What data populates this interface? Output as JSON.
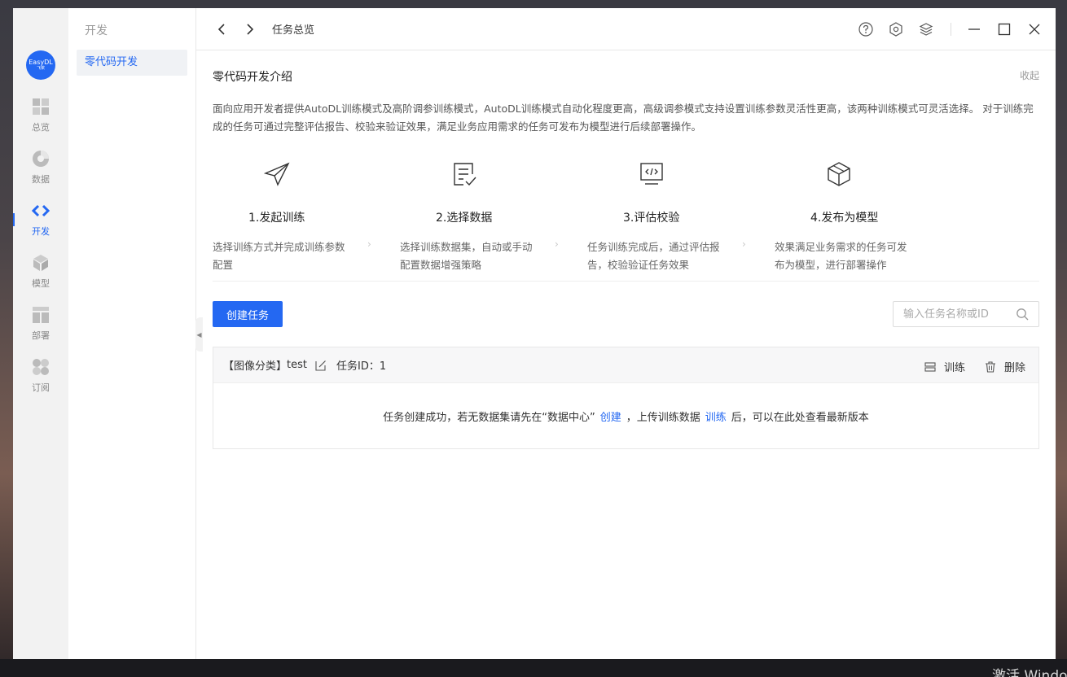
{
  "app": {
    "logo_text": "EasyDL",
    "logo_sub": "飞桨"
  },
  "rail": {
    "items": [
      {
        "label": "总览",
        "icon": "grid-icon"
      },
      {
        "label": "数据",
        "icon": "pie-icon"
      },
      {
        "label": "开发",
        "icon": "code-icon",
        "active": true
      },
      {
        "label": "模型",
        "icon": "cube-icon"
      },
      {
        "label": "部署",
        "icon": "deploy-icon"
      },
      {
        "label": "订阅",
        "icon": "subscribe-icon"
      }
    ]
  },
  "subnav": {
    "heading": "开发",
    "items": [
      {
        "label": "零代码开发",
        "active": true
      }
    ]
  },
  "topbar": {
    "breadcrumb": "任务总览",
    "icons": [
      "help-icon",
      "settings-icon",
      "layers-icon",
      "minimize-icon",
      "maximize-icon",
      "close-icon"
    ]
  },
  "intro": {
    "title": "零代码开发介绍",
    "collapse_label": "收起",
    "description": "面向应用开发者提供AutoDL训练模式及高阶调参训练模式，AutoDL训练模式自动化程度更高，高级调参模式支持设置训练参数灵活性更高，该两种训练模式可灵活选择。 对于训练完成的任务可通过完整评估报告、校验来验证效果，满足业务应用需求的任务可发布为模型进行后续部署操作。",
    "steps": [
      {
        "title": "1.发起训练",
        "desc": "选择训练方式并完成训练参数配置",
        "icon": "paper-plane-icon"
      },
      {
        "title": "2.选择数据",
        "desc": "选择训练数据集，自动或手动配置数据增强策略",
        "icon": "checklist-icon"
      },
      {
        "title": "3.评估校验",
        "desc": "任务训练完成后，通过评估报告，校验验证任务效果",
        "icon": "monitor-code-icon"
      },
      {
        "title": "4.发布为模型",
        "desc": "效果满足业务需求的任务可发布为模型，进行部署操作",
        "icon": "box-icon"
      }
    ]
  },
  "toolbar": {
    "create_label": "创建任务",
    "search_placeholder": "输入任务名称或ID"
  },
  "task": {
    "type_tag": "【图像分类】",
    "name": "test",
    "id_label": "任务ID：1",
    "ops": {
      "train": "训练",
      "delete": "删除"
    },
    "msg_part1": "任务创建成功，若无数据集请先在“数据中心”",
    "link_create": "创建",
    "msg_part2": "，上传训练数据",
    "link_train": "训练",
    "msg_part3": "后，可以在此处查看最新版本"
  },
  "desktop": {
    "watermark": "激活 Windows"
  },
  "colors": {
    "accent": "#2468f2"
  }
}
